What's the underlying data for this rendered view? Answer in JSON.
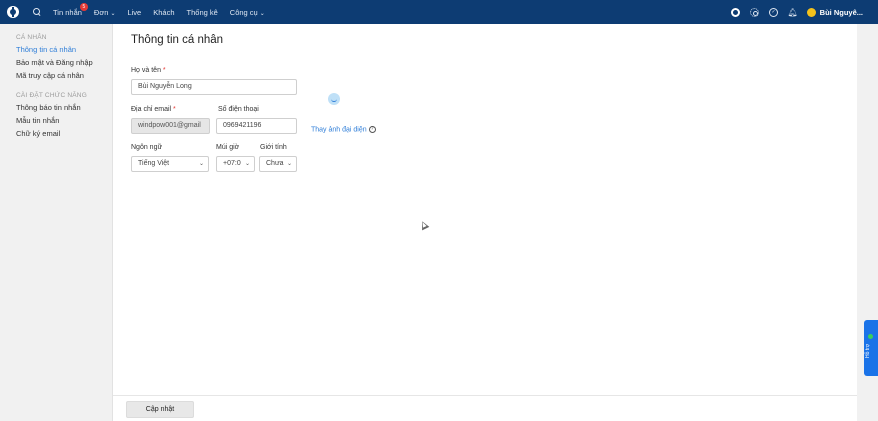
{
  "topbar": {
    "nav": {
      "messages": "Tin nhắn",
      "messages_badge": "5",
      "orders": "Đơn",
      "live": "Live",
      "customers": "Khách",
      "statistics": "Thống kê",
      "tools": "Công cụ"
    },
    "user_name": "Bùi Nguyê..."
  },
  "sidebar": {
    "section_personal": "CÁ NHÂN",
    "items_personal": [
      "Thông tin cá nhân",
      "Bảo mật và Đăng nhập",
      "Mã truy cập cá nhân"
    ],
    "section_settings": "CÀI ĐẶT CHỨC NĂNG",
    "items_settings": [
      "Thông báo tin nhắn",
      "Mẫu tin nhắn",
      "Chữ ký email"
    ]
  },
  "main": {
    "title": "Thông tin cá nhân",
    "fullname_label": "Họ và tên",
    "fullname_value": "Bùi Nguyễn Long",
    "email_label": "Địa chỉ email",
    "email_value": "windpow001@gmail",
    "phone_label": "Số điện thoại",
    "phone_value": "0969421196",
    "language_label": "Ngôn ngữ",
    "language_value": "Tiếng Việt",
    "timezone_label": "Múi giờ",
    "timezone_value": "+07:0",
    "gender_label": "Giới tính",
    "gender_value": "Chưa",
    "required_mark": "*",
    "change_avatar": "Thay ảnh đại diện",
    "update_button": "Cập nhật"
  },
  "support": {
    "label": "Hỗ trợ"
  },
  "colors": {
    "topbar": "#0d3c73",
    "accent": "#2f7ed8",
    "badge": "#e53935",
    "support": "#1a73e8"
  }
}
